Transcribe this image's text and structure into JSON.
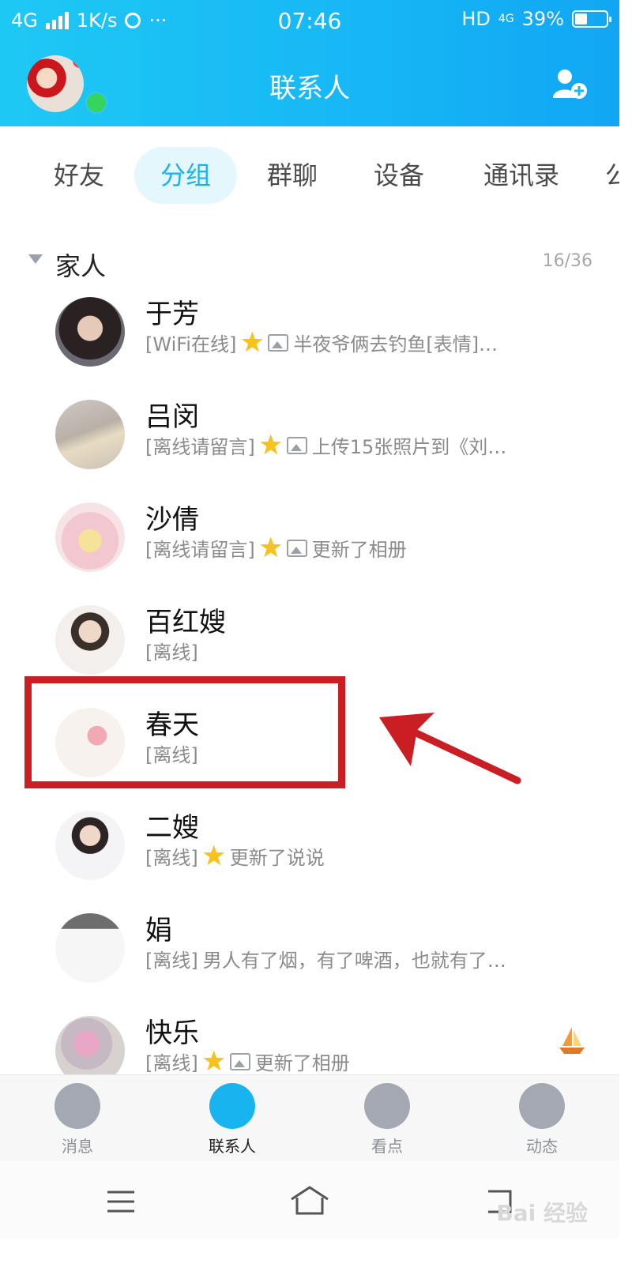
{
  "status_bar": {
    "network": "4G",
    "speed": "1K/s",
    "more": "···",
    "time": "07:46",
    "hd": "HD",
    "net2": "4G",
    "battery": "39%",
    "battery_level": 0.39
  },
  "header": {
    "title": "联系人"
  },
  "tabs": [
    {
      "label": "好友",
      "active": false
    },
    {
      "label": "分组",
      "active": true
    },
    {
      "label": "群聊",
      "active": false
    },
    {
      "label": "设备",
      "active": false
    },
    {
      "label": "通讯录",
      "active": false
    },
    {
      "label": "公",
      "active": false
    }
  ],
  "group": {
    "name": "家人",
    "count": "16/36"
  },
  "contacts": [
    {
      "name": "于芳",
      "status": "[WiFi在线]",
      "star": true,
      "image": true,
      "update": "半夜爷俩去钓鱼[表情]…"
    },
    {
      "name": "吕闵",
      "status": "[离线请留言]",
      "star": true,
      "image": true,
      "update": "上传15张照片到《刘…"
    },
    {
      "name": "沙倩",
      "status": "[离线请留言]",
      "star": true,
      "image": true,
      "update": "更新了相册"
    },
    {
      "name": "百红嫂",
      "status": "[离线]",
      "star": false,
      "image": false,
      "update": ""
    },
    {
      "name": "春天",
      "status": "[离线]",
      "star": false,
      "image": false,
      "update": ""
    },
    {
      "name": "二嫂",
      "status": "[离线]",
      "star": true,
      "image": false,
      "update": "更新了说说"
    },
    {
      "name": "娟",
      "status": "[离线]",
      "star": false,
      "image": false,
      "update": "男人有了烟，有了啤酒，也就有了…"
    },
    {
      "name": "快乐",
      "status": "[离线]",
      "star": true,
      "image": true,
      "update": "更新了相册"
    }
  ],
  "bottom_nav": [
    {
      "label": "消息",
      "icon": "chat-bubble-icon",
      "active": false
    },
    {
      "label": "联系人",
      "icon": "contacts-person-icon",
      "active": true
    },
    {
      "label": "看点",
      "icon": "eye-icon",
      "active": false
    },
    {
      "label": "动态",
      "icon": "star-planet-icon",
      "active": false
    }
  ],
  "watermark": "Bai 经验"
}
